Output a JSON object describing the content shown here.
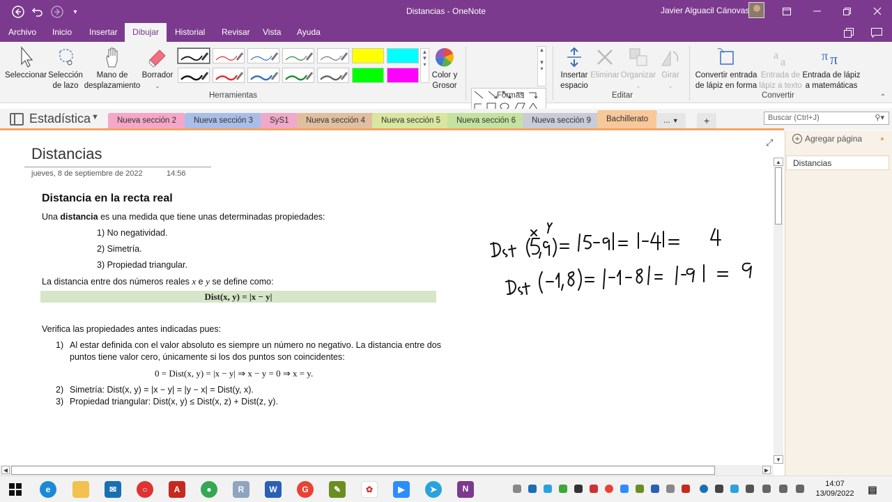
{
  "app": {
    "title": "Distancias - OneNote",
    "user": "Javier Alguacil Cánovas"
  },
  "menu": {
    "tabs": [
      "Archivo",
      "Inicio",
      "Insertar",
      "Dibujar",
      "Historial",
      "Revisar",
      "Vista",
      "Ayuda"
    ],
    "active": "Dibujar"
  },
  "ribbon": {
    "tools": {
      "select": "Seleccionar",
      "lasso_1": "Selección",
      "lasso_2": "de lazo",
      "pan_1": "Mano de",
      "pan_2": "desplazamiento",
      "eraser": "Borrador",
      "color_1": "Color y",
      "color_2": "Grosor",
      "group": "Herramientas"
    },
    "shapes_group": "Formas",
    "edit": {
      "insert_space_1": "Insertar",
      "insert_space_2": "espacio",
      "delete": "Eliminar",
      "arrange": "Organizar",
      "rotate": "Girar",
      "group": "Editar"
    },
    "convert": {
      "ink_shape_1": "Convertir entrada",
      "ink_shape_2": "de lápiz en forma",
      "ink_text_1": "Entrada de",
      "ink_text_2": "lápiz a texto",
      "ink_math_1": "Entrada de lápiz",
      "ink_math_2": "a matemáticas",
      "group": "Convertir"
    },
    "colors": {
      "accent": "#7b3a8d",
      "yellow": "#ffff00",
      "cyan": "#00ffff",
      "green": "#00ff00",
      "magenta": "#ff00ff"
    }
  },
  "notebook": {
    "name": "Estadística",
    "sections": [
      {
        "label": "Nueva sección 2",
        "color": "#f5a7c7"
      },
      {
        "label": "Nueva sección 3",
        "color": "#a9bde8"
      },
      {
        "label": "SyS1",
        "color": "#f0a9c8"
      },
      {
        "label": "Nueva sección 4",
        "color": "#e0bfa0"
      },
      {
        "label": "Nueva sección 5",
        "color": "#d8e6a0"
      },
      {
        "label": "Nueva sección 6",
        "color": "#c4e2a0"
      },
      {
        "label": "Nueva sección 9",
        "color": "#c8ccd8"
      },
      {
        "label": "Bachillerato",
        "color": "#f8c89a"
      }
    ],
    "more": "...",
    "add": "+",
    "search_placeholder": "Buscar (Ctrl+J)"
  },
  "page": {
    "title": "Distancias",
    "date": "jueves, 8 de septiembre de 2022",
    "time": "14:56",
    "heading": "Distancia en la recta real",
    "intro_pre": "Una ",
    "intro_bold": "distancia",
    "intro_post": " es una medida que tiene unas determinadas propiedades:",
    "props": [
      "1) No negatividad.",
      "2) Simetría.",
      "3) Propiedad triangular."
    ],
    "def_pre": "La distancia entre dos números reales ",
    "def_x": "x",
    "def_mid": " e ",
    "def_y": "y",
    "def_post": " se define como:",
    "formula": "Dist(x, y) = |x − y|",
    "verify": "Verifica las propiedades antes indicadas pues:",
    "item1_num": "1)",
    "item1_line1": "Al estar definida con el valor absoluto es siempre un número no negativo. La distancia entre dos",
    "item1_line2": "puntos tiene valor cero, únicamente si los dos puntos son coincidentes:",
    "item1_formula": "0 = Dist(x, y) = |x − y| ⇒ x − y = 0 ⇒ x = y.",
    "item2_num": "2)",
    "item2": "Simetría: Dist(x, y) = |x − y| = |y − x| = Dist(y, x).",
    "item3_num": "3)",
    "item3": "Propiedad triangular: Dist(x, y) ≤ Dist(x, z) + Dist(z, y)."
  },
  "sidepane": {
    "add_page": "Agregar página",
    "pages": [
      "Distancias"
    ]
  },
  "taskbar": {
    "time": "14:07",
    "date": "13/09/2022"
  }
}
